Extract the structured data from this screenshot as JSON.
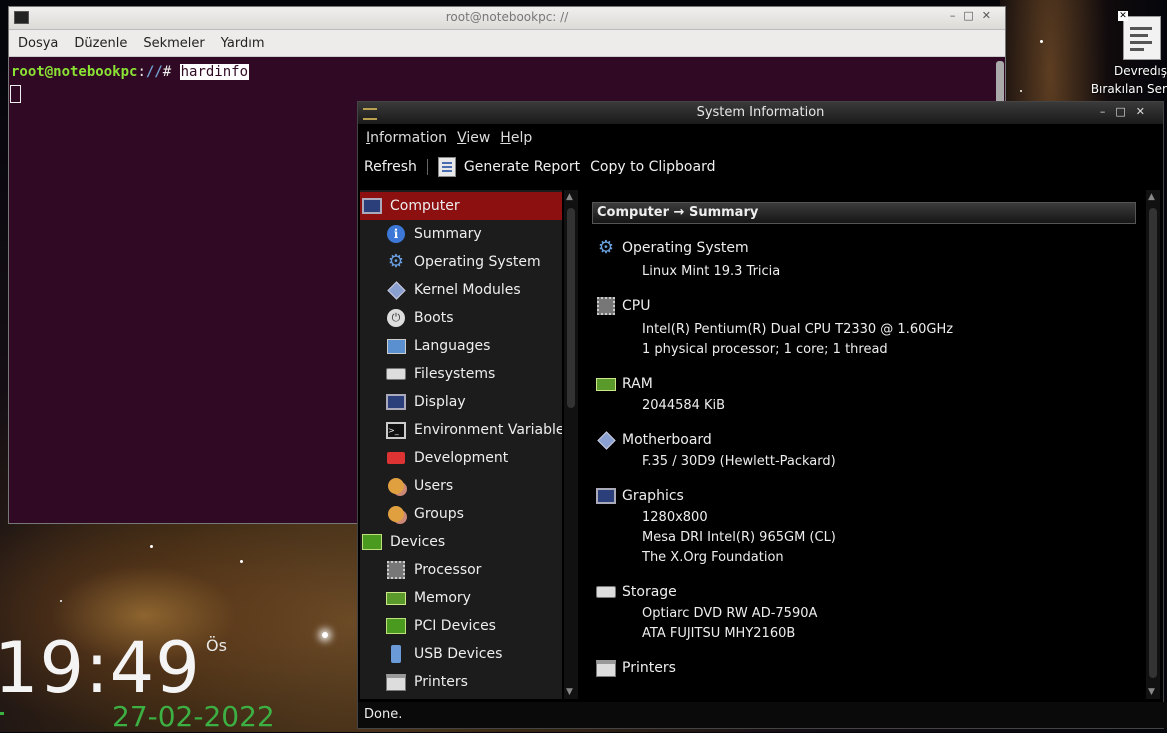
{
  "desktop": {
    "icon_labels": [
      "Devredış",
      "Bırakılan Ser"
    ],
    "clock": {
      "time": "19:49",
      "ampm": "Ös",
      "date": "27-02-2022"
    }
  },
  "terminal": {
    "title": "root@notebookpc: //",
    "menu": [
      "Dosya",
      "Düzenle",
      "Sekmeler",
      "Yardım"
    ],
    "prompt_user": "root@notebookpc",
    "prompt_sep": ":",
    "prompt_path": "//",
    "prompt_symbol": "# ",
    "command": "hardinfo"
  },
  "hardinfo": {
    "title": "System Information",
    "menu": [
      "Information",
      "View",
      "Help"
    ],
    "toolbar": {
      "refresh": "Refresh",
      "generate_report": "Generate Report",
      "copy": "Copy to Clipboard"
    },
    "sidebar": [
      {
        "label": "Computer",
        "level": 0,
        "icon": "monitor-icon",
        "selected": true
      },
      {
        "label": "Summary",
        "level": 1,
        "icon": "info-icon"
      },
      {
        "label": "Operating System",
        "level": 1,
        "icon": "gear-icon"
      },
      {
        "label": "Kernel Modules",
        "level": 1,
        "icon": "module-icon"
      },
      {
        "label": "Boots",
        "level": 1,
        "icon": "power-icon"
      },
      {
        "label": "Languages",
        "level": 1,
        "icon": "flag-icon"
      },
      {
        "label": "Filesystems",
        "level": 1,
        "icon": "disk-icon"
      },
      {
        "label": "Display",
        "level": 1,
        "icon": "monitor-icon"
      },
      {
        "label": "Environment Variables",
        "level": 1,
        "icon": "terminal-icon"
      },
      {
        "label": "Development",
        "level": 1,
        "icon": "development-icon"
      },
      {
        "label": "Users",
        "level": 1,
        "icon": "users-icon"
      },
      {
        "label": "Groups",
        "level": 1,
        "icon": "groups-icon"
      },
      {
        "label": "Devices",
        "level": 0,
        "icon": "board-icon"
      },
      {
        "label": "Processor",
        "level": 1,
        "icon": "chip-icon"
      },
      {
        "label": "Memory",
        "level": 1,
        "icon": "ram-icon"
      },
      {
        "label": "PCI Devices",
        "level": 1,
        "icon": "board-icon"
      },
      {
        "label": "USB Devices",
        "level": 1,
        "icon": "usb-icon"
      },
      {
        "label": "Printers",
        "level": 1,
        "icon": "printer-icon"
      }
    ],
    "breadcrumb": "Computer → Summary",
    "summary": {
      "os": {
        "title": "Operating System",
        "values": [
          "Linux Mint 19.3 Tricia"
        ]
      },
      "cpu": {
        "title": "CPU",
        "values": [
          "Intel(R) Pentium(R) Dual  CPU  T2330  @ 1.60GHz",
          "1 physical processor; 1 core; 1 thread"
        ]
      },
      "ram": {
        "title": "RAM",
        "values": [
          "2044584 KiB"
        ]
      },
      "motherboard": {
        "title": "Motherboard",
        "values": [
          "F.35 / 30D9 (Hewlett-Packard)"
        ]
      },
      "graphics": {
        "title": "Graphics",
        "values": [
          "1280x800",
          "Mesa DRI Intel(R) 965GM (CL)",
          "The X.Org Foundation"
        ]
      },
      "storage": {
        "title": "Storage",
        "values": [
          "Optiarc DVD RW AD-7590A",
          "ATA FUJITSU MHY2160B"
        ]
      },
      "printers": {
        "title": "Printers",
        "values": []
      }
    },
    "status": "Done."
  },
  "colors": {
    "selection": "#8c1010",
    "terminal_bg": "#300a24",
    "prompt_green": "#8ae234",
    "prompt_blue": "#729fcf",
    "clock_date": "#3cb043"
  }
}
